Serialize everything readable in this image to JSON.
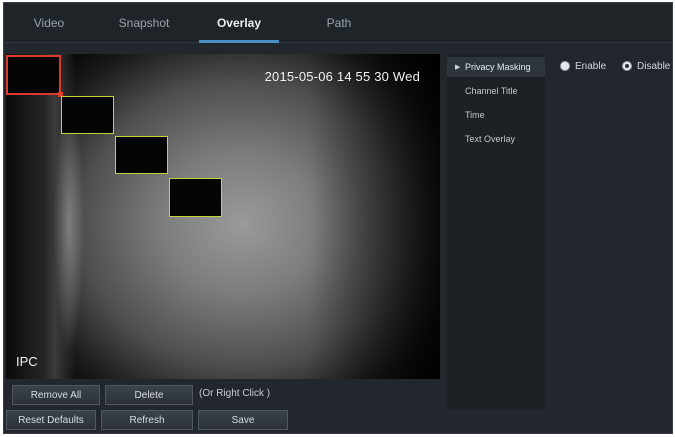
{
  "tabs": [
    {
      "label": "Video",
      "active": false
    },
    {
      "label": "Snapshot",
      "active": false
    },
    {
      "label": "Overlay",
      "active": true
    },
    {
      "label": "Path",
      "active": false
    }
  ],
  "video": {
    "timestamp": "2015-05-06 14 55 30 Wed",
    "channel_title": "IPC"
  },
  "buttons": {
    "remove_all": "Remove All",
    "delete": "Delete",
    "delete_hint": "(Or Right Click )",
    "reset_defaults": "Reset Defaults",
    "refresh": "Refresh",
    "save": "Save"
  },
  "overlay_menu": {
    "items": [
      {
        "label": "Privacy Masking",
        "active": true
      },
      {
        "label": "Channel Title",
        "active": false
      },
      {
        "label": "Time",
        "active": false
      },
      {
        "label": "Text Overlay",
        "active": false
      }
    ]
  },
  "privacy_masking": {
    "options": [
      {
        "label": "Enable",
        "checked": false
      },
      {
        "label": "Disable",
        "checked": true
      }
    ]
  },
  "colors": {
    "accent": "#4a90c8",
    "mask_border": "#c7d13c",
    "selected_mask_border": "#d93a2b",
    "background": "#22272d"
  }
}
